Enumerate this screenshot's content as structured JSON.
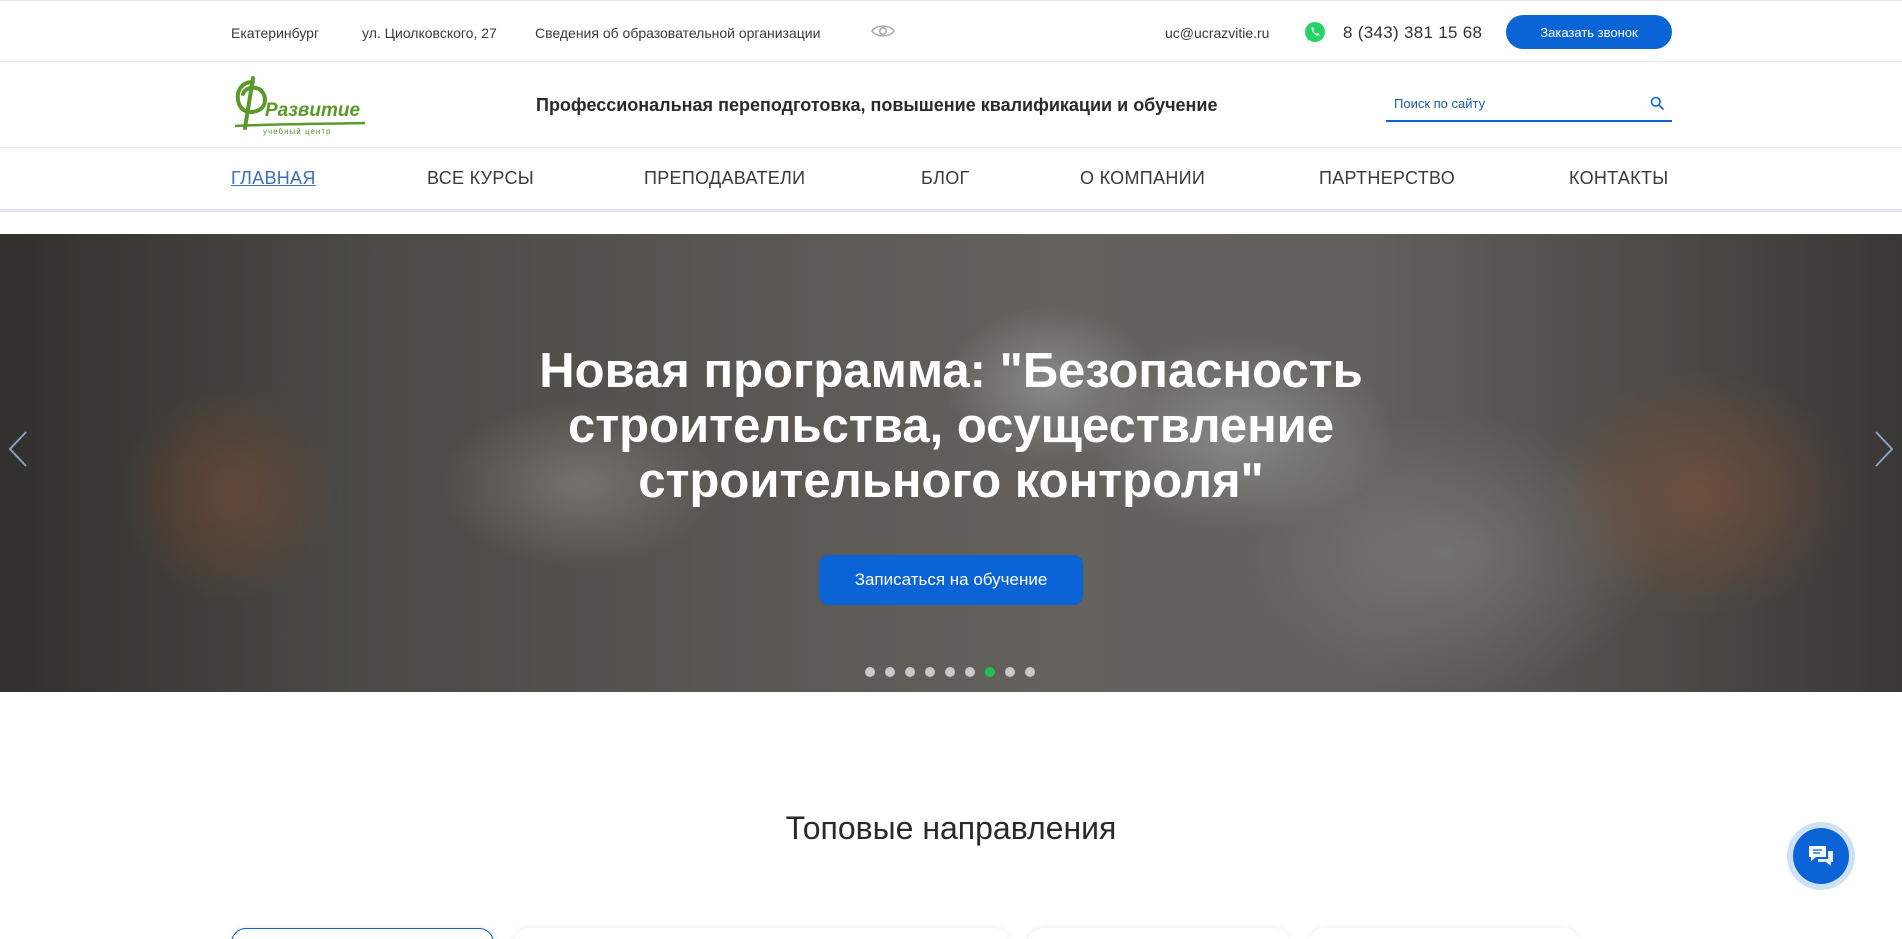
{
  "topbar": {
    "city": "Екатеринбург",
    "address": "ул. Циолковского, 27",
    "org_info": "Сведения об образовательной организации",
    "email": "uc@ucrazvitie.ru",
    "phone": "8 (343) 381 15 68",
    "callback_label": "Заказать звонок"
  },
  "header": {
    "logo_text": "Развитие",
    "logo_sub": "учебный центр",
    "tagline": "Профессиональная переподготовка, повышение квалификации и обучение",
    "search_placeholder": "Поиск по сайту"
  },
  "nav": {
    "items": [
      {
        "label": "ГЛАВНАЯ"
      },
      {
        "label": "ВСЕ КУРСЫ"
      },
      {
        "label": "ПРЕПОДАВАТЕЛИ"
      },
      {
        "label": "БЛОГ"
      },
      {
        "label": "О КОМПАНИИ"
      },
      {
        "label": "ПАРТНЕРСТВО"
      },
      {
        "label": "КОНТАКТЫ"
      }
    ],
    "active_index": 0
  },
  "hero": {
    "title": "Новая программа: \"Безопасность строительства, осуществление строительного контроля\"",
    "cta_label": "Записаться на обучение",
    "slide_count": 9,
    "active_slide": 7
  },
  "sections": {
    "top_directions_title": "Топовые направления"
  },
  "colors": {
    "accent": "#0a64d6",
    "logo_green": "#5a9a2a",
    "active_dot": "#22c14a",
    "nav_active": "#3d6fbd"
  },
  "icons": {
    "eye": "eye-icon",
    "whatsapp": "whatsapp-icon",
    "search": "search-icon",
    "prev": "chevron-left-icon",
    "next": "chevron-right-icon",
    "chat": "chat-icon"
  }
}
